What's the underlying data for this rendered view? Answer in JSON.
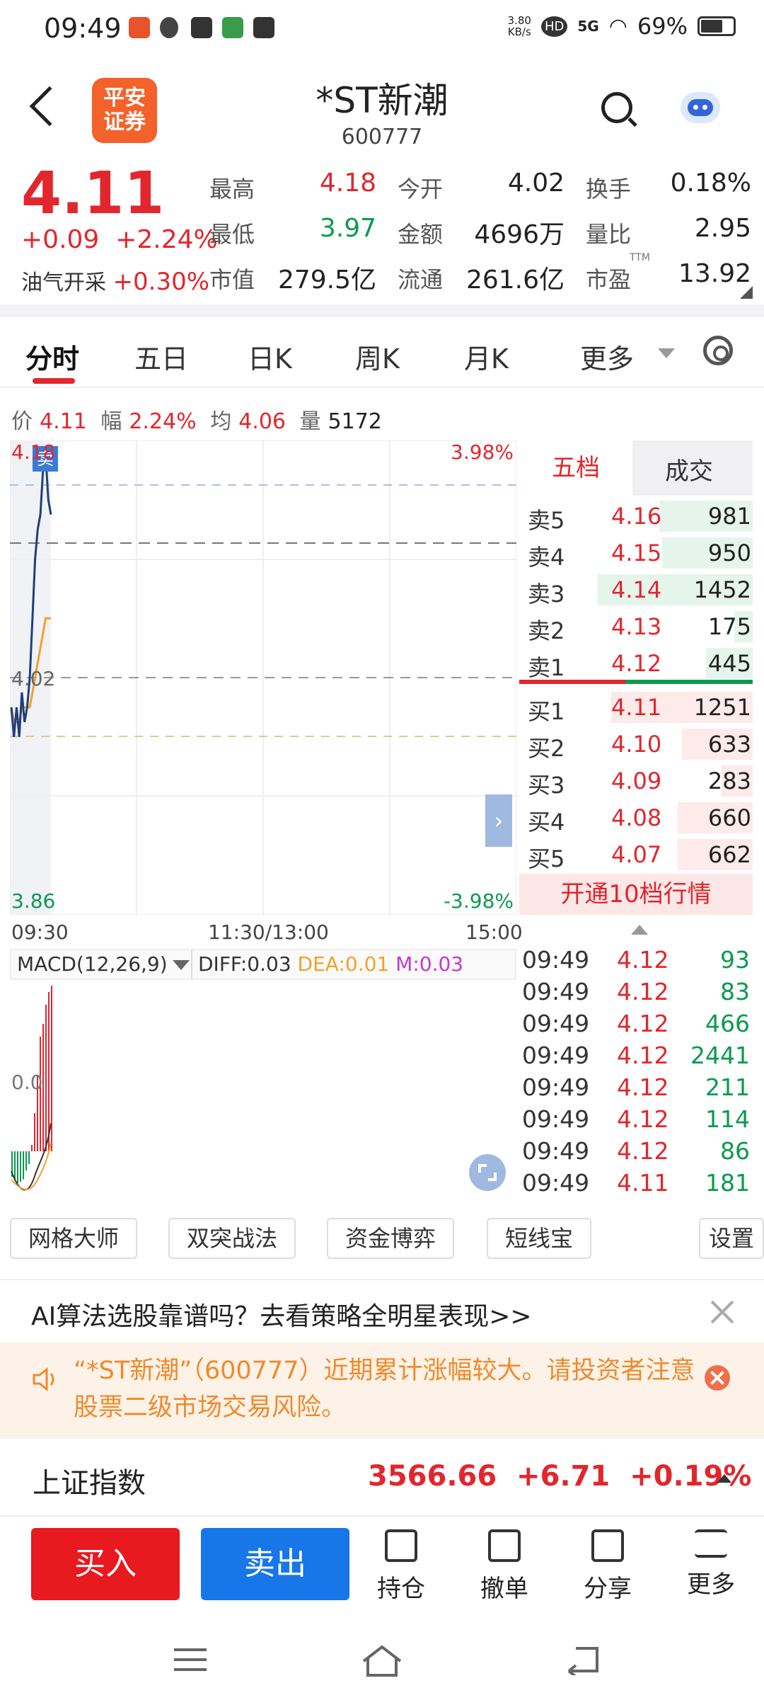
{
  "status_bar": {
    "time": "09:49",
    "net_speed": "3.80",
    "net_unit": "KB/s",
    "hd": "HD",
    "signal": "5G",
    "battery": "69%"
  },
  "header": {
    "logo_line1": "平安",
    "logo_line2": "证券",
    "title": "*ST新潮",
    "code": "600777"
  },
  "quote": {
    "price": "4.11",
    "change": "+0.09",
    "change_pct": "+2.24%",
    "sector_name": "油气开采",
    "sector_pct": "+0.30%",
    "stats": [
      {
        "label": "最高",
        "value": "4.18",
        "color": "#e2262d"
      },
      {
        "label": "今开",
        "value": "4.02",
        "color": "#222222"
      },
      {
        "label": "换手",
        "value": "0.18%",
        "color": "#222222"
      },
      {
        "label": "最低",
        "value": "3.97",
        "color": "#0c9a4f"
      },
      {
        "label": "金额",
        "value": "4696万",
        "color": "#222222"
      },
      {
        "label": "量比",
        "value": "2.95",
        "color": "#222222"
      },
      {
        "label": "市值",
        "value": "279.5亿",
        "color": "#222222"
      },
      {
        "label": "流通",
        "value": "261.6亿",
        "color": "#222222"
      },
      {
        "label": "市盈",
        "value": "13.92",
        "color": "#222222"
      }
    ],
    "ttm": "TTM"
  },
  "tabs": [
    {
      "label": "分时",
      "active": true
    },
    {
      "label": "五日",
      "active": false
    },
    {
      "label": "日K",
      "active": false
    },
    {
      "label": "周K",
      "active": false
    },
    {
      "label": "月K",
      "active": false
    },
    {
      "label": "更多",
      "active": false
    }
  ],
  "info_line": {
    "price_label": "价",
    "price": "4.11",
    "range_label": "幅",
    "range": "2.24%",
    "avg_label": "均",
    "avg": "4.06",
    "vol_label": "量",
    "vol": "5172"
  },
  "chart_data": {
    "type": "line",
    "top_left": "4.18",
    "mid_left": "4.02",
    "bottom_left": "3.86",
    "top_right": "3.98%",
    "bottom_right": "-3.98%",
    "sell_marker": "卖",
    "x_labels": [
      "09:30",
      "11:30/13:00",
      "15:00"
    ],
    "ylim": [
      3.86,
      4.18
    ],
    "prev_close": 4.02,
    "series": [
      {
        "values": [
          4.0,
          3.98,
          4.0,
          3.98,
          4.01,
          3.99,
          4.0,
          4.02,
          4.06,
          4.1,
          4.12,
          4.13,
          4.16,
          4.17,
          4.14,
          4.13
        ]
      },
      {
        "values": [
          4.0,
          3.99,
          3.99,
          3.99,
          4.0,
          4.0,
          4.0,
          4.0,
          4.01,
          4.02,
          4.03,
          4.04,
          4.05,
          4.06,
          4.06,
          4.06
        ]
      }
    ]
  },
  "macd": {
    "label": "MACD(12,26,9)",
    "diff": "DIFF:0.03",
    "dea": "DEA:0.01",
    "m": "M:0.03",
    "zero_label": "0.0"
  },
  "order_book": {
    "tab_active": "五档",
    "tab_other": "成交",
    "asks": [
      {
        "name": "卖5",
        "price": "4.16",
        "vol": "981",
        "fill": 0.6
      },
      {
        "name": "卖4",
        "price": "4.15",
        "vol": "950",
        "fill": 0.58
      },
      {
        "name": "卖3",
        "price": "4.14",
        "vol": "1452",
        "fill": 1.0
      },
      {
        "name": "卖2",
        "price": "4.13",
        "vol": "175",
        "fill": 0.12
      },
      {
        "name": "卖1",
        "price": "4.12",
        "vol": "445",
        "fill": 0.3
      }
    ],
    "bids": [
      {
        "name": "买1",
        "price": "4.11",
        "vol": "1251",
        "fill": 1.0
      },
      {
        "name": "买2",
        "price": "4.10",
        "vol": "633",
        "fill": 0.5
      },
      {
        "name": "买3",
        "price": "4.09",
        "vol": "283",
        "fill": 0.22
      },
      {
        "name": "买4",
        "price": "4.08",
        "vol": "660",
        "fill": 0.53
      },
      {
        "name": "买5",
        "price": "4.07",
        "vol": "662",
        "fill": 0.53
      }
    ],
    "open10": "开通10档行情"
  },
  "ticks": [
    {
      "time": "09:49",
      "price": "4.12",
      "vol": "93"
    },
    {
      "time": "09:49",
      "price": "4.12",
      "vol": "83"
    },
    {
      "time": "09:49",
      "price": "4.12",
      "vol": "466"
    },
    {
      "time": "09:49",
      "price": "4.12",
      "vol": "2441"
    },
    {
      "time": "09:49",
      "price": "4.12",
      "vol": "211"
    },
    {
      "time": "09:49",
      "price": "4.12",
      "vol": "114"
    },
    {
      "time": "09:49",
      "price": "4.12",
      "vol": "86"
    },
    {
      "time": "09:49",
      "price": "4.11",
      "vol": "181"
    }
  ],
  "tools": [
    "网格大师",
    "双突战法",
    "资金博弈",
    "短线宝",
    "设置"
  ],
  "ai_banner": "AI算法选股靠谱吗？去看策略全明星表现>>",
  "warning": "“*ST新潮”（600777）近期累计涨幅较大。请投资者注意股票二级市场交易风险。",
  "index": {
    "name": "上证指数",
    "value": "3566.66",
    "change": "+6.71",
    "pct": "+0.19%"
  },
  "actions": {
    "buy": "买入",
    "sell": "卖出",
    "hold": "持仓",
    "cancel": "撤单",
    "share": "分享",
    "more": "更多"
  },
  "colors": {
    "up": "#e2262d",
    "down": "#0c9a4f",
    "buy": "#e8191f",
    "sell": "#1776e8",
    "warn": "#ef8a2c"
  }
}
